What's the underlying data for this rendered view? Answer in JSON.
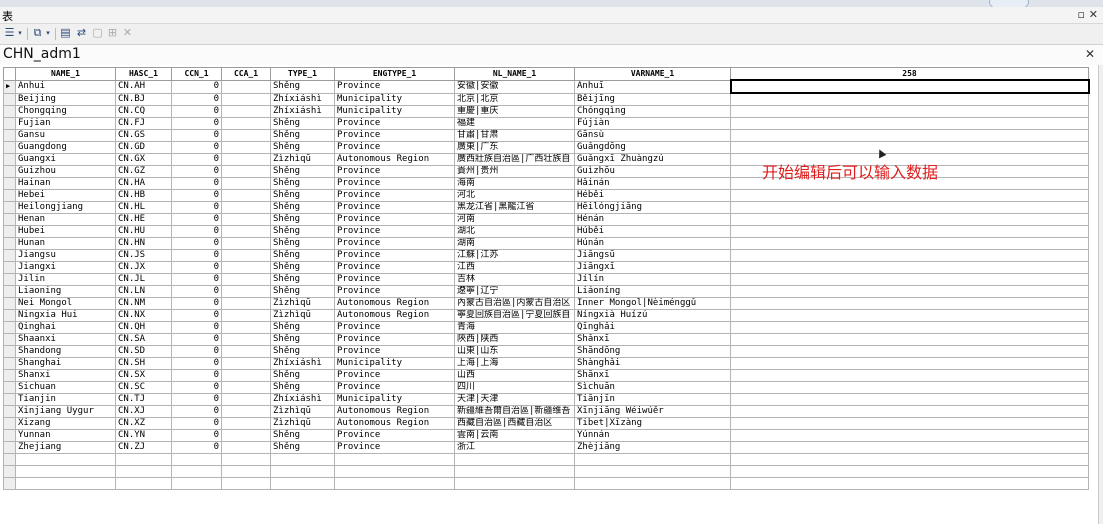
{
  "window": {
    "title": "表",
    "pin_icon": "pin-icon",
    "close_icon": "close-icon"
  },
  "toolbar": {
    "icons": [
      "table-options-icon",
      "dropdown-arrow-icon",
      "related-tables-icon",
      "dropdown-arrow-icon",
      "select-by-attributes-icon",
      "switch-selection-icon",
      "clear-selection-icon",
      "zoom-to-selected-icon",
      "delete-selected-icon"
    ]
  },
  "tab": {
    "title": "CHN_adm1"
  },
  "grid": {
    "columns": [
      "NAME_1",
      "HASC_1",
      "CCN_1",
      "CCA_1",
      "TYPE_1",
      "ENGTYPE_1",
      "NL_NAME_1",
      "VARNAME_1",
      "258"
    ],
    "rows": [
      [
        "Anhui",
        "CN.AH",
        "0",
        "",
        "Shěng",
        "Province",
        "安徽|安徽",
        "Anhuī",
        ""
      ],
      [
        "Beijing",
        "CN.BJ",
        "0",
        "",
        "Zhíxiáshì",
        "Municipality",
        "北京|北京",
        "Běijīng",
        ""
      ],
      [
        "Chongqing",
        "CN.CQ",
        "0",
        "",
        "Zhíxiáshì",
        "Municipality",
        "重慶|重庆",
        "Chóngqìng",
        ""
      ],
      [
        "Fujian",
        "CN.FJ",
        "0",
        "",
        "Shěng",
        "Province",
        "福建",
        "Fújiàn",
        ""
      ],
      [
        "Gansu",
        "CN.GS",
        "0",
        "",
        "Shěng",
        "Province",
        "甘肅|甘肃",
        "Gānsù",
        ""
      ],
      [
        "Guangdong",
        "CN.GD",
        "0",
        "",
        "Shěng",
        "Province",
        "廣東|广东",
        "Guǎngdōng",
        ""
      ],
      [
        "Guangxi",
        "CN.GX",
        "0",
        "",
        "Zìzhìqū",
        "Autonomous Region",
        "廣西壯族自治區|广西壮族自",
        "Guǎngxī Zhuàngzú",
        ""
      ],
      [
        "Guizhou",
        "CN.GZ",
        "0",
        "",
        "Shěng",
        "Province",
        "貴州|贵州",
        "Guìzhōu",
        ""
      ],
      [
        "Hainan",
        "CN.HA",
        "0",
        "",
        "Shěng",
        "Province",
        "海南",
        "Hǎinán",
        ""
      ],
      [
        "Hebei",
        "CN.HB",
        "0",
        "",
        "Shěng",
        "Province",
        "河北",
        "Héběi",
        ""
      ],
      [
        "Heilongjiang",
        "CN.HL",
        "0",
        "",
        "Shěng",
        "Province",
        "黑龙江省|黑龍江省",
        "Hēilóngjiāng",
        ""
      ],
      [
        "Henan",
        "CN.HE",
        "0",
        "",
        "Shěng",
        "Province",
        "河南",
        "Hénán",
        ""
      ],
      [
        "Hubei",
        "CN.HU",
        "0",
        "",
        "Shěng",
        "Province",
        "湖北",
        "Húběi",
        ""
      ],
      [
        "Hunan",
        "CN.HN",
        "0",
        "",
        "Shěng",
        "Province",
        "湖南",
        "Húnán",
        ""
      ],
      [
        "Jiangsu",
        "CN.JS",
        "0",
        "",
        "Shěng",
        "Province",
        "江蘇|江苏",
        "Jiāngsū",
        ""
      ],
      [
        "Jiangxi",
        "CN.JX",
        "0",
        "",
        "Shěng",
        "Province",
        "江西",
        "Jiāngxī",
        ""
      ],
      [
        "Jilin",
        "CN.JL",
        "0",
        "",
        "Shěng",
        "Province",
        "吉林",
        "Jílín",
        ""
      ],
      [
        "Liaoning",
        "CN.LN",
        "0",
        "",
        "Shěng",
        "Province",
        "遼寧|辽宁",
        "Liáoníng",
        ""
      ],
      [
        "Nei Mongol",
        "CN.NM",
        "0",
        "",
        "Zìzhìqū",
        "Autonomous Region",
        "內蒙古自治區|内蒙古自治区",
        "Inner Mongol|Nèiménggǔ",
        ""
      ],
      [
        "Ningxia Hui",
        "CN.NX",
        "0",
        "",
        "Zìzhìqū",
        "Autonomous Region",
        "寧夏回族自治區|宁夏回族自",
        "Níngxià Huízú",
        ""
      ],
      [
        "Qinghai",
        "CN.QH",
        "0",
        "",
        "Shěng",
        "Province",
        "青海",
        "Qīnghǎi",
        ""
      ],
      [
        "Shaanxi",
        "CN.SA",
        "0",
        "",
        "Shěng",
        "Province",
        "陝西|陕西",
        "Shǎnxī",
        ""
      ],
      [
        "Shandong",
        "CN.SD",
        "0",
        "",
        "Shěng",
        "Province",
        "山東|山东",
        "Shāndōng",
        ""
      ],
      [
        "Shanghai",
        "CN.SH",
        "0",
        "",
        "Zhíxiáshì",
        "Municipality",
        "上海|上海",
        "Shànghǎi",
        ""
      ],
      [
        "Shanxi",
        "CN.SX",
        "0",
        "",
        "Shěng",
        "Province",
        "山西",
        "Shānxī",
        ""
      ],
      [
        "Sichuan",
        "CN.SC",
        "0",
        "",
        "Shěng",
        "Province",
        "四川",
        "Sìchuān",
        ""
      ],
      [
        "Tianjin",
        "CN.TJ",
        "0",
        "",
        "Zhíxiáshì",
        "Municipality",
        "天津|天津",
        "Tiānjīn",
        ""
      ],
      [
        "Xinjiang Uygur",
        "CN.XJ",
        "0",
        "",
        "Zìzhìqū",
        "Autonomous Region",
        "新疆維吾爾自治區|新疆维吾",
        "Xīnjiāng Wéiwúěr",
        ""
      ],
      [
        "Xizang",
        "CN.XZ",
        "0",
        "",
        "Zìzhìqū",
        "Autonomous Region",
        "西藏自治區|西藏自治区",
        "Tibet|Xīzàng",
        ""
      ],
      [
        "Yunnan",
        "CN.YN",
        "0",
        "",
        "Shěng",
        "Province",
        "雲南|云南",
        "Yúnnán",
        ""
      ],
      [
        "Zhejiang",
        "CN.ZJ",
        "0",
        "",
        "Shěng",
        "Province",
        "浙江",
        "Zhèjiāng",
        ""
      ]
    ]
  },
  "annotation": "开始编辑后可以输入数据"
}
